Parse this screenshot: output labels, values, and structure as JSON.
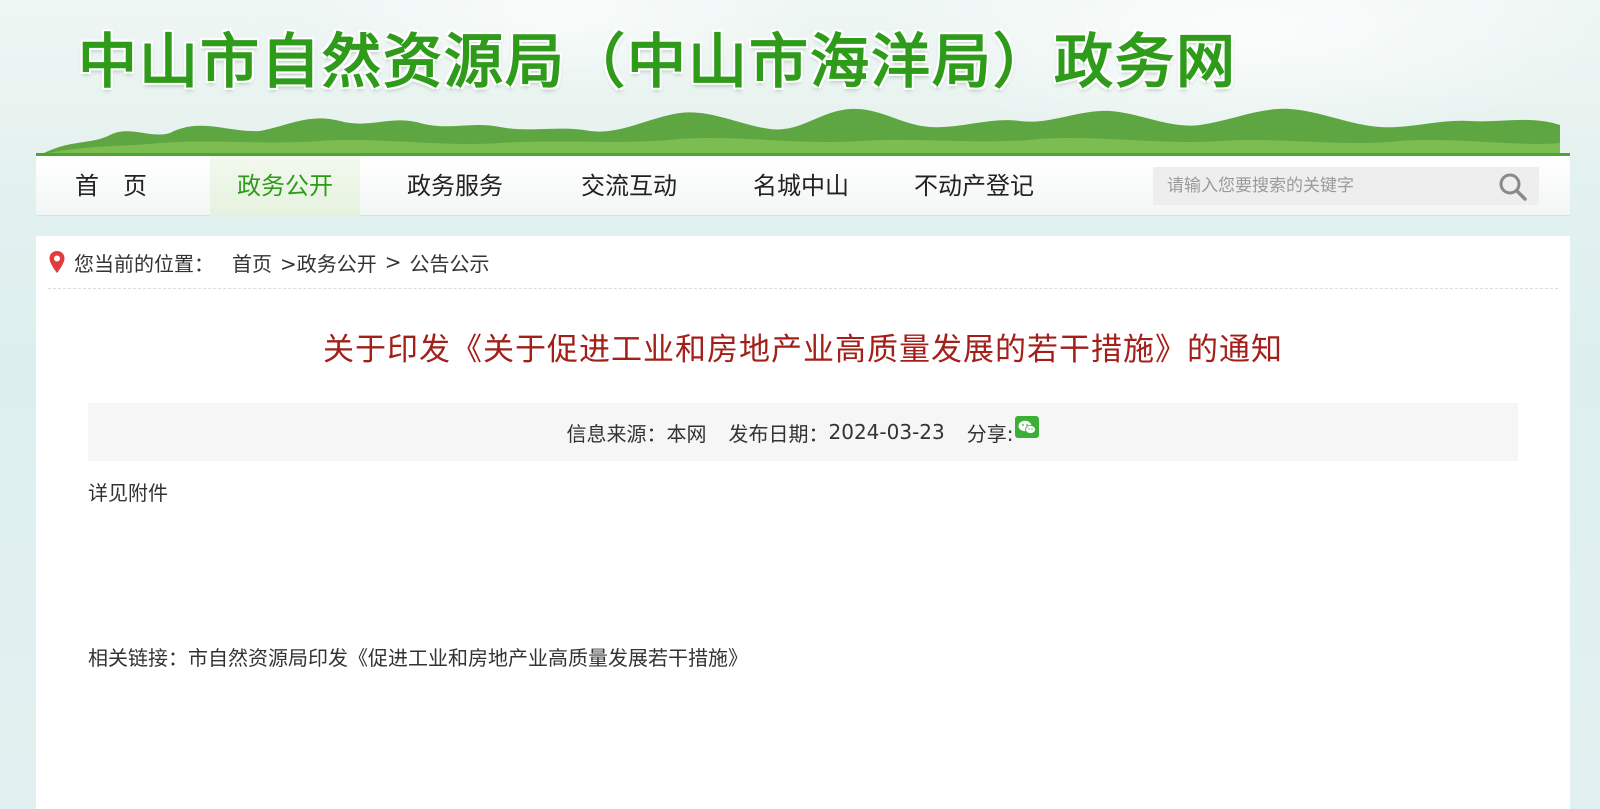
{
  "header": {
    "site_title": "中山市自然资源局（中山市海洋局）政务网"
  },
  "nav": {
    "items": [
      {
        "label": "首　页"
      },
      {
        "label": "政务公开"
      },
      {
        "label": "政务服务"
      },
      {
        "label": "交流互动"
      },
      {
        "label": "名城中山"
      },
      {
        "label": "不动产登记"
      }
    ],
    "active_index": 1
  },
  "search": {
    "placeholder": "请输入您要搜索的关键字",
    "icon": "search-icon"
  },
  "breadcrumb": {
    "prefix": "您当前的位置：",
    "home": "首页",
    "section": ">政务公开",
    "separator": ">",
    "current": "公告公示",
    "icon": "location-pin-icon"
  },
  "article": {
    "title": "关于印发《关于促进工业和房地产业高质量发展的若干措施》的通知",
    "source_label": "信息来源：",
    "source_value": "本网",
    "date_label": "发布日期：",
    "date_value": "2024-03-23",
    "share_label": "分享:",
    "share_icon": "wechat-icon",
    "body": "详见附件",
    "related_label": "相关链接：",
    "related_link": "市自然资源局印发《促进工业和房地产业高质量发展若干措施》"
  },
  "colors": {
    "brand_green": "#2f9b1a",
    "title_red": "#a31f1a",
    "pin_red": "#e23b3b",
    "wechat_green": "#3cb034"
  }
}
